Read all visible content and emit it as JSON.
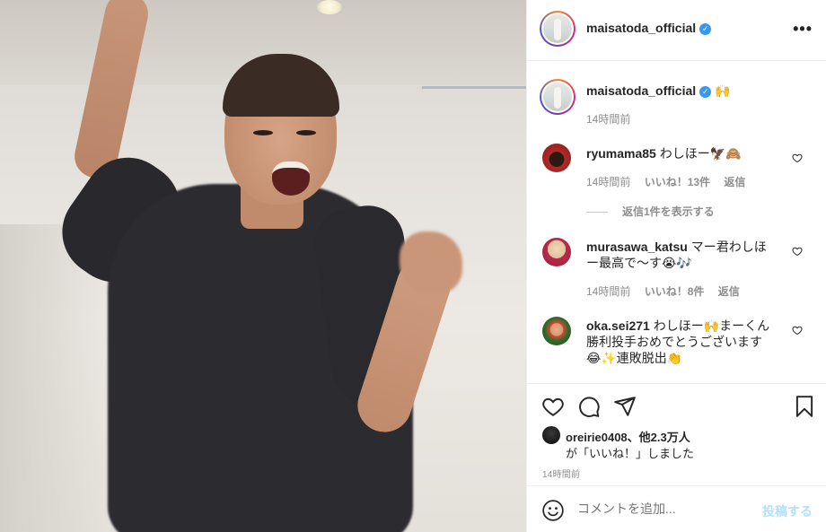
{
  "header": {
    "username": "maisatoda_official",
    "more_label": "•••"
  },
  "caption": {
    "username": "maisatoda_official",
    "text": "🙌",
    "time": "14時間前"
  },
  "comments": [
    {
      "username": "ryumama85",
      "text": "わしほー🦅🙈",
      "time": "14時間前",
      "likes": "いいね！13件",
      "reply": "返信",
      "view_replies": "返信1件を表示する",
      "avatar_colors": [
        "#7a1f1f",
        "#c33"
      ]
    },
    {
      "username": "murasawa_katsu",
      "text": "マー君わしほー最高で〜す😭🎶",
      "time": "14時間前",
      "likes": "いいね！8件",
      "reply": "返信",
      "avatar_colors": [
        "#b72b4a",
        "#f0d7b8"
      ]
    },
    {
      "username": "oka.sei271",
      "text": "わしほー🙌まーくん勝利投手おめでとうございます😂✨連敗脱出👏",
      "avatar_colors": [
        "#2f6b2a",
        "#d43"
      ]
    }
  ],
  "likes": {
    "line1_user": "oreirie0408",
    "line1_rest": "、他2.3万人",
    "line2": "が「いいね！」しました"
  },
  "post_time": "14時間前",
  "comment_box": {
    "placeholder": "コメントを追加...",
    "post_label": "投稿する"
  },
  "icons": {
    "like": "heart-icon",
    "comment": "comment-icon",
    "share": "share-icon",
    "save": "bookmark-icon",
    "emoji": "smiley-icon",
    "verified": "verified-badge-icon"
  },
  "colors": {
    "verified_blue": "#3897f0",
    "post_button_disabled": "#b2dffc",
    "meta_gray": "#8e8e8e"
  }
}
